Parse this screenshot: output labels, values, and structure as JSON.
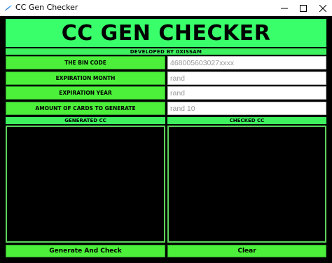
{
  "window": {
    "title": "CC Gen Checker",
    "icons": {
      "app": "feather-icon",
      "minimize": "minimize-icon",
      "maximize": "maximize-icon",
      "close": "close-icon"
    }
  },
  "header": {
    "title": "CC GEN CHECKER",
    "developer": "DEVELOPED BY 0XISSAM"
  },
  "form": {
    "bin": {
      "label": "THE BIN CODE",
      "value": "468005603027xxxx"
    },
    "month": {
      "label": "EXPIRATION MONTH",
      "value": "rand"
    },
    "year": {
      "label": "EXPIRATION YEAR",
      "value": "rand"
    },
    "amount": {
      "label": "AMOUNT OF CARDS TO GENERATE",
      "value": "rand 10"
    }
  },
  "panels": {
    "generated_label": "GENERATED CC",
    "checked_label": "CHECKED CC",
    "generated_text": "",
    "checked_text": ""
  },
  "buttons": {
    "generate": "Generate And Check",
    "clear": "Clear"
  },
  "colors": {
    "accent": "#39ff6a",
    "label_bg": "#4cef3a",
    "panel_border": "#5bd35a",
    "background": "#000000"
  }
}
